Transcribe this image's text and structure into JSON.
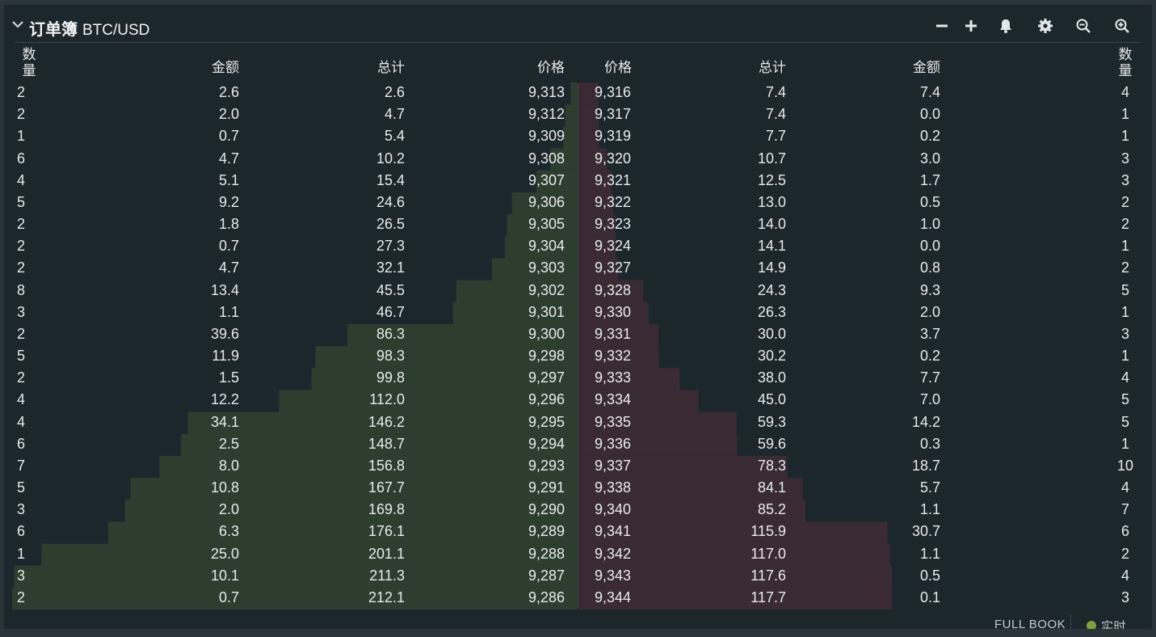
{
  "header": {
    "title": "订单簿",
    "pair": "BTC/USD",
    "tools": [
      "minus-icon",
      "plus-icon",
      "bell-icon",
      "gear-icon",
      "zoom-out-icon",
      "zoom-in-icon"
    ]
  },
  "columns": {
    "bids": {
      "count": "数量",
      "amount": "金额",
      "total": "总计",
      "price": "价格"
    },
    "asks": {
      "price": "价格",
      "total": "总计",
      "amount": "金额",
      "count": "数量"
    }
  },
  "colors": {
    "bid_depth": "#2d3e2f",
    "ask_depth": "#3a2a33",
    "live": "#7fa33a"
  },
  "bids": [
    {
      "count": "2",
      "amount": "2.6",
      "total": "2.6",
      "price": "9,313"
    },
    {
      "count": "2",
      "amount": "2.0",
      "total": "4.7",
      "price": "9,312"
    },
    {
      "count": "1",
      "amount": "0.7",
      "total": "5.4",
      "price": "9,309"
    },
    {
      "count": "6",
      "amount": "4.7",
      "total": "10.2",
      "price": "9,308"
    },
    {
      "count": "4",
      "amount": "5.1",
      "total": "15.4",
      "price": "9,307"
    },
    {
      "count": "5",
      "amount": "9.2",
      "total": "24.6",
      "price": "9,306"
    },
    {
      "count": "2",
      "amount": "1.8",
      "total": "26.5",
      "price": "9,305"
    },
    {
      "count": "2",
      "amount": "0.7",
      "total": "27.3",
      "price": "9,304"
    },
    {
      "count": "2",
      "amount": "4.7",
      "total": "32.1",
      "price": "9,303"
    },
    {
      "count": "8",
      "amount": "13.4",
      "total": "45.5",
      "price": "9,302"
    },
    {
      "count": "3",
      "amount": "1.1",
      "total": "46.7",
      "price": "9,301"
    },
    {
      "count": "2",
      "amount": "39.6",
      "total": "86.3",
      "price": "9,300"
    },
    {
      "count": "5",
      "amount": "11.9",
      "total": "98.3",
      "price": "9,298"
    },
    {
      "count": "2",
      "amount": "1.5",
      "total": "99.8",
      "price": "9,297"
    },
    {
      "count": "4",
      "amount": "12.2",
      "total": "112.0",
      "price": "9,296"
    },
    {
      "count": "4",
      "amount": "34.1",
      "total": "146.2",
      "price": "9,295"
    },
    {
      "count": "6",
      "amount": "2.5",
      "total": "148.7",
      "price": "9,294"
    },
    {
      "count": "7",
      "amount": "8.0",
      "total": "156.8",
      "price": "9,293"
    },
    {
      "count": "5",
      "amount": "10.8",
      "total": "167.7",
      "price": "9,291"
    },
    {
      "count": "3",
      "amount": "2.0",
      "total": "169.8",
      "price": "9,290"
    },
    {
      "count": "6",
      "amount": "6.3",
      "total": "176.1",
      "price": "9,289"
    },
    {
      "count": "1",
      "amount": "25.0",
      "total": "201.1",
      "price": "9,288"
    },
    {
      "count": "3",
      "amount": "10.1",
      "total": "211.3",
      "price": "9,287"
    },
    {
      "count": "2",
      "amount": "0.7",
      "total": "212.1",
      "price": "9,286"
    }
  ],
  "asks": [
    {
      "price": "9,316",
      "total": "7.4",
      "amount": "7.4",
      "count": "4"
    },
    {
      "price": "9,317",
      "total": "7.4",
      "amount": "0.0",
      "count": "1"
    },
    {
      "price": "9,319",
      "total": "7.7",
      "amount": "0.2",
      "count": "1"
    },
    {
      "price": "9,320",
      "total": "10.7",
      "amount": "3.0",
      "count": "3"
    },
    {
      "price": "9,321",
      "total": "12.5",
      "amount": "1.7",
      "count": "3"
    },
    {
      "price": "9,322",
      "total": "13.0",
      "amount": "0.5",
      "count": "2"
    },
    {
      "price": "9,323",
      "total": "14.0",
      "amount": "1.0",
      "count": "2"
    },
    {
      "price": "9,324",
      "total": "14.1",
      "amount": "0.0",
      "count": "1"
    },
    {
      "price": "9,327",
      "total": "14.9",
      "amount": "0.8",
      "count": "2"
    },
    {
      "price": "9,328",
      "total": "24.3",
      "amount": "9.3",
      "count": "5"
    },
    {
      "price": "9,330",
      "total": "26.3",
      "amount": "2.0",
      "count": "1"
    },
    {
      "price": "9,331",
      "total": "30.0",
      "amount": "3.7",
      "count": "3"
    },
    {
      "price": "9,332",
      "total": "30.2",
      "amount": "0.2",
      "count": "1"
    },
    {
      "price": "9,333",
      "total": "38.0",
      "amount": "7.7",
      "count": "4"
    },
    {
      "price": "9,334",
      "total": "45.0",
      "amount": "7.0",
      "count": "5"
    },
    {
      "price": "9,335",
      "total": "59.3",
      "amount": "14.2",
      "count": "5"
    },
    {
      "price": "9,336",
      "total": "59.6",
      "amount": "0.3",
      "count": "1"
    },
    {
      "price": "9,337",
      "total": "78.3",
      "amount": "18.7",
      "count": "10"
    },
    {
      "price": "9,338",
      "total": "84.1",
      "amount": "5.7",
      "count": "4"
    },
    {
      "price": "9,340",
      "total": "85.2",
      "amount": "1.1",
      "count": "7"
    },
    {
      "price": "9,341",
      "total": "115.9",
      "amount": "30.7",
      "count": "6"
    },
    {
      "price": "9,342",
      "total": "117.0",
      "amount": "1.1",
      "count": "2"
    },
    {
      "price": "9,343",
      "total": "117.6",
      "amount": "0.5",
      "count": "4"
    },
    {
      "price": "9,344",
      "total": "117.7",
      "amount": "0.1",
      "count": "3"
    }
  ],
  "depth_scale_max": 212.1,
  "footer": {
    "full_book": "FULL BOOK",
    "live": "实时"
  }
}
